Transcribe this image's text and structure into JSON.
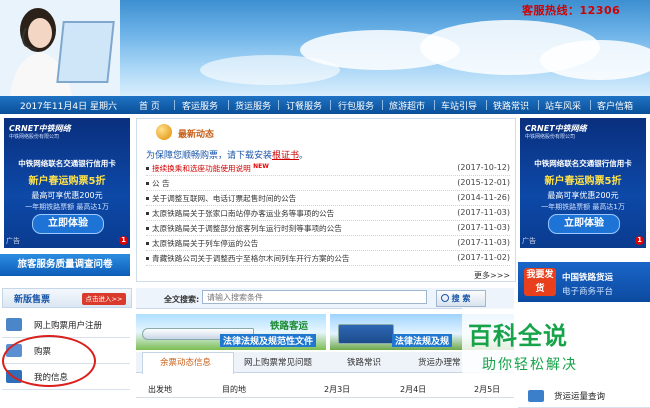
{
  "header": {
    "hotline": "客服热线：12306",
    "date": "2017年11月4日 星期六"
  },
  "nav": {
    "items": [
      "首 页",
      "客运服务",
      "货运服务",
      "订餐服务",
      "行包服务",
      "旅游超市",
      "车站引导",
      "铁路常识",
      "站车风采",
      "客户信箱"
    ]
  },
  "ad_left": {
    "logo": "CRNET中铁网络",
    "logo_sub": "中铁网络股份有限公司",
    "line1": "中铁网络联名交通银行信用卡",
    "line2": "新户春运购票5折",
    "line3": "最高可享优惠200元",
    "line4": "一年期铁路票额 最高达1万",
    "button": "立即体验",
    "tag": "广告",
    "close": "1"
  },
  "ad_right": {
    "logo": "CRNET中铁网络",
    "logo_sub": "中铁网络股份有限公司",
    "line1": "中铁网络联名交通银行信用卡",
    "line2": "新户春运购票5折",
    "line3": "最高可享优惠200元",
    "line4": "一年期铁路票额 最高达1万",
    "button": "立即体验",
    "tag": "广告",
    "close": "1"
  },
  "news": {
    "title": "最新动态",
    "notice_prefix": "为保障您顺畅购票，请下载安装",
    "notice_link": "根证书",
    "notice_suffix": "。",
    "new_tag": "NEW",
    "more": "更多>>>",
    "items": [
      {
        "text": "接续换乘和选座功能使用说明",
        "date": "(2017-10-12)",
        "red": true
      },
      {
        "text": "公 告",
        "date": "(2015-12-01)",
        "red": false
      },
      {
        "text": "关于调整互联网、电话订票起售时间的公告",
        "date": "(2014-11-26)",
        "red": false
      },
      {
        "text": "太原铁路局关于张家口南站停办客运业务等事项的公告",
        "date": "(2017-11-03)",
        "red": false
      },
      {
        "text": "太原铁路局关于调整部分旅客列车运行时刻等事项的公告",
        "date": "(2017-11-03)",
        "red": false
      },
      {
        "text": "太原铁路局关于列车停运的公告",
        "date": "(2017-11-03)",
        "red": false
      },
      {
        "text": "青藏铁路公司关于调整西宁至格尔木间列车开行方案的公告",
        "date": "(2017-11-02)",
        "red": false
      }
    ]
  },
  "left": {
    "survey": "旅客服务质量调查问卷",
    "new_ticket_title": "新版售票",
    "enter_button": "点击进入>>",
    "items": [
      "网上购票用户注册",
      "购票",
      "我的信息"
    ]
  },
  "search": {
    "label": "全文搜索:",
    "placeholder": "请输入搜索条件",
    "button": "搜 索"
  },
  "banners": {
    "left_title": "铁路客运",
    "left_sub": "法律法规及规范性文件",
    "right_sub": "法律法规及规"
  },
  "tabs": [
    "余票动态信息",
    "网上购票常见问题",
    "铁路常识",
    "货运办理常"
  ],
  "table_head": [
    "出发地",
    "目的地",
    "2月3日",
    "2月4日",
    "2月5日"
  ],
  "right": {
    "freight_badge": "我要发货",
    "freight_t1": "中国铁路货运",
    "freight_t2": "电子商务平台",
    "item_bottom": "货运运量查询"
  },
  "watermark": {
    "main": "百科全说",
    "sub": "助你轻松解决"
  },
  "colors": {
    "nav_blue": "#0a4f99",
    "ad_blue": "#0d49a8",
    "hotline_red": "#d10000",
    "watermark_green": "#17a34a",
    "circle_red": "#d9201c"
  }
}
